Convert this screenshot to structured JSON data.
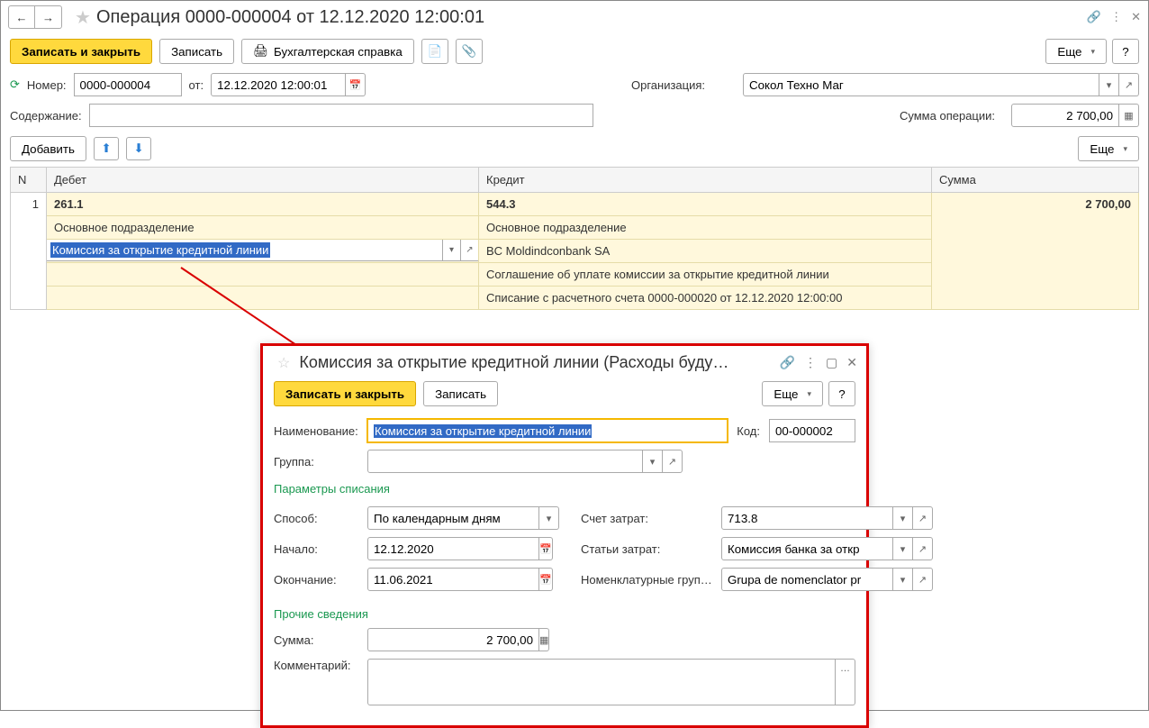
{
  "header": {
    "title": "Операция 0000-000004 от 12.12.2020 12:00:01"
  },
  "toolbar": {
    "save_close": "Записать и закрыть",
    "save": "Записать",
    "accounting_note": "Бухгалтерская справка",
    "more": "Еще"
  },
  "form": {
    "number_label": "Номер:",
    "number": "0000-000004",
    "from_label": "от:",
    "date": "12.12.2020 12:00:01",
    "org_label": "Организация:",
    "org": "Сокол Техно Маг",
    "content_label": "Содержание:",
    "sum_label": "Сумма операции:",
    "sum": "2 700,00",
    "add": "Добавить"
  },
  "grid": {
    "headers": {
      "n": "N",
      "debit": "Дебет",
      "credit": "Кредит",
      "sum": "Сумма"
    },
    "row": {
      "n": "1",
      "sum": "2 700,00",
      "debit": {
        "account": "261.1",
        "l1": "Основное подразделение",
        "l2": "Комиссия за открытие кредитной линии"
      },
      "credit": {
        "account": "544.3",
        "l1": "Основное подразделение",
        "l2": "BC Moldindconbank SA",
        "l3": "Соглашение об уплате комиссии за открытие кредитной линии",
        "l4": "Списание с расчетного счета 0000-000020 от 12.12.2020 12:00:00"
      }
    }
  },
  "popup": {
    "title": "Комиссия за открытие кредитной линии (Расходы буду…",
    "save_close": "Записать и закрыть",
    "save": "Записать",
    "more": "Еще",
    "name_label": "Наименование:",
    "name": "Комиссия за открытие кредитной линии",
    "code_label": "Код:",
    "code": "00-000002",
    "group_label": "Группа:",
    "group": "",
    "section1": "Параметры списания",
    "method_label": "Способ:",
    "method": "По календарным дням",
    "start_label": "Начало:",
    "start": "12.12.2020",
    "end_label": "Окончание:",
    "end": "11.06.2021",
    "acct_label": "Счет затрат:",
    "acct": "713.8",
    "items_label": "Статьи затрат:",
    "items": "Комиссия банка за откр",
    "nomgroup_label": "Номенклатурные груп…",
    "nomgroup": "Grupa de nomenclator pr",
    "section2": "Прочие сведения",
    "sum_label": "Сумма:",
    "sum": "2 700,00",
    "comment_label": "Комментарий:",
    "comment": ""
  }
}
